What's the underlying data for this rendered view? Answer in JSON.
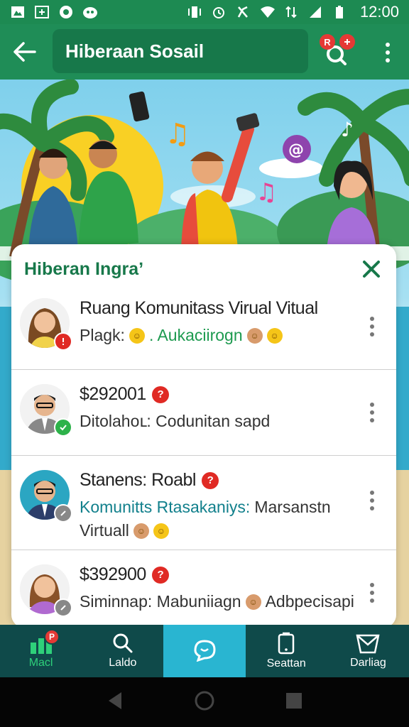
{
  "status_bar": {
    "time": "12:00"
  },
  "app_bar": {
    "title": "Hiberaan Sosail",
    "search_badge": "R"
  },
  "sheet": {
    "title": "Hiberan Ingraʼ",
    "items": [
      {
        "line1": "Ruang Komunitass Virual Vitual",
        "line2_prefix": "Plagk:",
        "line2_highlight": ". Aukaciirogn"
      },
      {
        "line1": "$292001",
        "line2": "Ditolahoւ: Codunitan sapd"
      },
      {
        "line1": "Stanens: Roabl",
        "line2_highlight": "Komunitts Rtasakaniys:",
        "line2_rest": " Marsanstn",
        "line3": "Virtuall"
      },
      {
        "line1": "$392900",
        "line2_prefix": "Siminnap: Mabuniiagn",
        "line2_rest": "Adbpecisapi"
      }
    ]
  },
  "bottom_nav": {
    "items": [
      {
        "label": "Macl",
        "badge": "P"
      },
      {
        "label": "Laldo"
      },
      {
        "label": ""
      },
      {
        "label": "Seattan"
      },
      {
        "label": "Darliag"
      }
    ]
  },
  "colors": {
    "primary": "#1f8d57",
    "accent": "#29b5d1",
    "nav_bg": "#0f4a4a",
    "badge": "#e02a24"
  }
}
